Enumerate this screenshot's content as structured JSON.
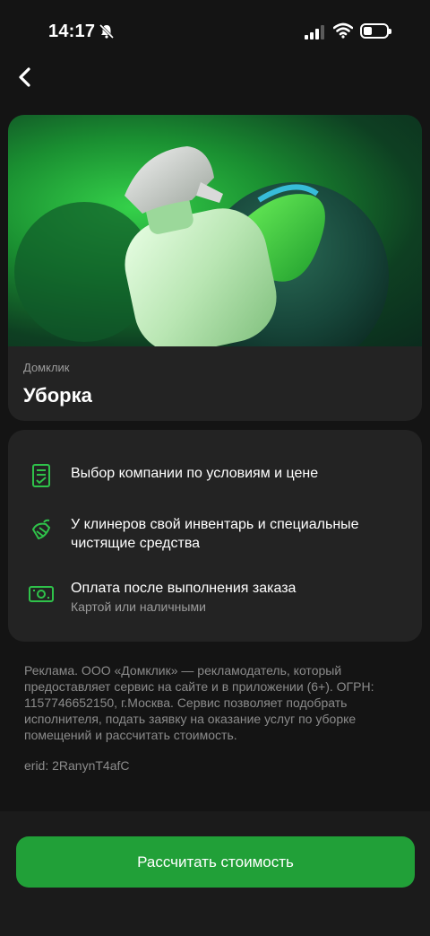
{
  "status_bar": {
    "time": "14:17",
    "icons": [
      "bell-muted-icon",
      "cellular-signal-icon",
      "wifi-icon",
      "battery-icon"
    ]
  },
  "nav": {
    "back_icon": "chevron-left-icon"
  },
  "service": {
    "provider": "Домклик",
    "title": "Уборка"
  },
  "features": [
    {
      "icon": "checklist-document-icon",
      "text": "Выбор компании по условиям и цене"
    },
    {
      "icon": "cleaning-brush-icon",
      "text": "У клинеров свой инвентарь и специальные чистящие средства"
    },
    {
      "icon": "cash-banknote-icon",
      "text": "Оплата после выполнения заказа",
      "subtext": "Картой или наличными"
    }
  ],
  "disclaimer": "Реклама. ООО «Домклик» — рекламодатель, который предоставляет сервис на сайте и в приложении (6+). ОГРН: 1157746652150, г.Москва. Сервис позволяет подобрать исполнителя, подать заявку на оказание услуг по уборке помещений и рассчитать стоимость.",
  "erid": "erid: 2RanynT4afC",
  "cta": {
    "label": "Рассчитать стоимость"
  },
  "colors": {
    "accent": "#21a038",
    "icon_green": "#2fc24a",
    "background": "#141414",
    "card": "#232323"
  }
}
